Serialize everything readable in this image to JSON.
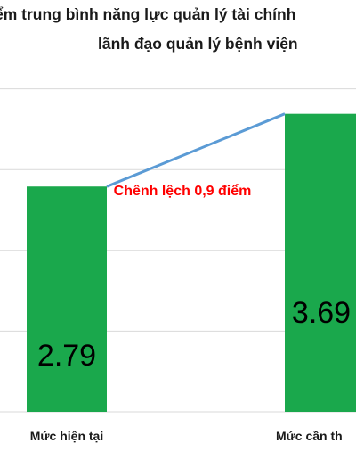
{
  "chart_data": {
    "type": "bar",
    "title_line1": "ểm trung bình năng lực quản lý tài chính",
    "title_line2": "lãnh đạo quản lý bệnh viện",
    "categories": [
      "Mức hiện tại",
      "Mức cần th"
    ],
    "values": [
      2.79,
      3.69
    ],
    "data_labels": [
      "2.79",
      "3.69"
    ],
    "annotation": "Chênh lệch 0,9 điểm",
    "ylim": [
      0,
      5
    ],
    "grid": true,
    "connector_line": true,
    "colors": {
      "bar": "#1aa84c",
      "connector": "#5b9bd5",
      "annotation": "#ff0000",
      "grid": "#d9d9d9"
    }
  }
}
